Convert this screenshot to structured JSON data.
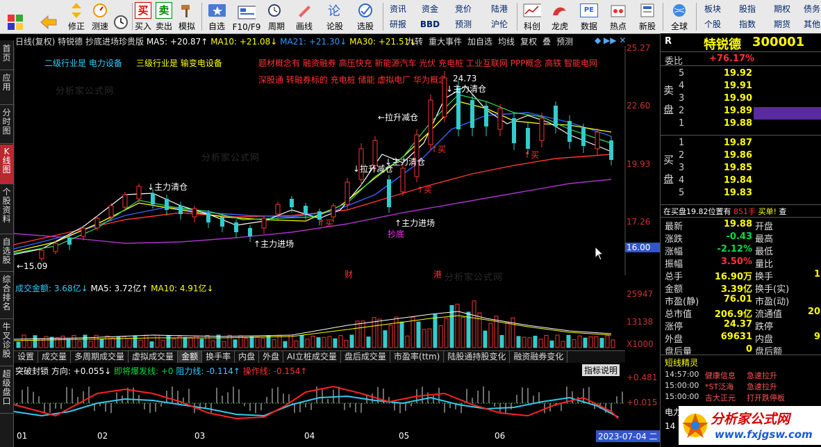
{
  "toolbar": {
    "items": [
      {
        "label": "",
        "icon": "grid-icon"
      },
      {
        "label": "",
        "icon": "back-arrow-icon"
      },
      {
        "label": "修正",
        "icon": "up-down-icon"
      },
      {
        "label": "测速",
        "icon": "speed-icon"
      },
      {
        "label": "买入",
        "icon": "buy-icon"
      },
      {
        "label": "卖出",
        "icon": "sell-icon"
      },
      {
        "label": "模拟",
        "icon": "hammer-icon"
      },
      {
        "label": "自选",
        "icon": "star-icon"
      },
      {
        "label": "F10/F9",
        "icon": "f10-icon"
      },
      {
        "label": "周期",
        "icon": "period-icon"
      },
      {
        "label": "画线",
        "icon": "pencil-icon"
      },
      {
        "label": "论股",
        "icon": "forum-icon"
      },
      {
        "label": "选股",
        "icon": "select-icon"
      },
      {
        "label": "科创",
        "icon": "kechuang-icon"
      },
      {
        "label": "龙虎",
        "icon": "dragon-icon"
      },
      {
        "label": "数据",
        "icon": "pe-icon"
      },
      {
        "label": "热点",
        "icon": "hotspot-icon"
      },
      {
        "label": "新股",
        "icon": "newstock-icon"
      },
      {
        "label": "全球",
        "icon": "globe-icon"
      }
    ],
    "buttons_a": [
      "资讯",
      "资金",
      "竞价",
      "陆港",
      "研报",
      "BBD",
      "预测",
      "沪伦"
    ],
    "buttons_b": [
      "板块",
      "股指",
      "期权",
      "债务",
      "个股",
      "指数",
      "期货",
      "其他"
    ]
  },
  "leftnav": [
    "首页",
    "应用",
    "分时图",
    "K线图",
    "个股资料",
    "自选股",
    "综合排名",
    "牛叉诊股",
    "超级盘口"
  ],
  "chart": {
    "header_left": "日线(复权)  特锐德  抄底进场珍贵版",
    "ma5": "MA5: +20.87↑",
    "ma10": "MA10: +21.08↓",
    "ma21": "MA21: +21.30↓",
    "ma30": "MA30: +21.51↓",
    "tags_top": [
      "九转",
      "重大事件",
      "加自选",
      "均线",
      "复权",
      "叠",
      "预测"
    ],
    "industry2": "二级行业是  电力设备",
    "industry3": "三级行业是  输变电设备",
    "concepts1": "题材概念有  融资融券  高压快充  新能源汽车  光伏    充电桩  工业互联网  PPP概念  高铁  智能电网",
    "concepts2": "深股通  转融券标的  充电桩  储能  虚拟电厂  华为概念",
    "price_axis": [
      "25.27",
      "22.60",
      "19.93",
      "17.26",
      "16.00"
    ],
    "annotations": {
      "low": "←15.09",
      "high": "24.73",
      "main_enter1": "主力进场",
      "main_enter2": "主力进场",
      "main_clear1": "主力清仓",
      "main_clear2": "主力清仓",
      "main_clear3": "主力清仓",
      "lift_reduce": "拉升减仓",
      "lift_reduce2": "拉升减仓",
      "buy": "买",
      "bottom": "抄底",
      "cai": "财",
      "gang": "港"
    },
    "volume_header": "成交金额: 3.68亿↓",
    "vol_ma5": "MA5: 3.72亿↑",
    "vol_ma10": "MA10: 4.91亿↓",
    "vol_axis": [
      "25947",
      "13138",
      "X1000"
    ],
    "tabs": [
      "设置",
      "成交量",
      "多周期成交量",
      "虚拟成交量",
      "金额",
      "换手率",
      "内盘",
      "外盘",
      "AI立桩成交量",
      "盘后成交量",
      "市盈率(ttm)",
      "陆股通持股变化",
      "融资融券变化"
    ],
    "indicator_header": "突破封锁 方向: +0.055↓",
    "ind_line1": "即将爆发线: +0",
    "ind_line2": "阻力线: -0.114↑",
    "ind_line3": "操作线: -0.154↑",
    "ind_desc": "指标说明",
    "ind_axis": [
      "+0.481",
      "+0.015"
    ],
    "x_axis": [
      "01",
      "02",
      "03",
      "04",
      "05",
      "06"
    ],
    "date_label": "2023-07-04 二"
  },
  "stock": {
    "code": "R",
    "name": "特锐德",
    "number": "300001",
    "weibi_label": "委比",
    "weibi_value": "+76.17%",
    "sell_label": "卖盘",
    "buy_label": "买盘",
    "sells": [
      [
        "5",
        "19.92"
      ],
      [
        "4",
        "19.91"
      ],
      [
        "3",
        "19.90"
      ],
      [
        "2",
        "19.89"
      ],
      [
        "1",
        "19.88"
      ]
    ],
    "buys": [
      [
        "1",
        "19.87"
      ],
      [
        "2",
        "19.86"
      ],
      [
        "3",
        "19.85"
      ],
      [
        "4",
        "19.84"
      ],
      [
        "5",
        "19.83"
      ]
    ],
    "note": "在买盘19.82位置有",
    "note_val": "851手",
    "note_tail": "买单!",
    "note_tail2": "查",
    "stats_left": [
      [
        "最新",
        "19.88"
      ],
      [
        "涨跌",
        "-0.43"
      ],
      [
        "涨幅",
        "-2.12%"
      ],
      [
        "振幅",
        "3.50%"
      ],
      [
        "总手",
        "16.90万"
      ],
      [
        "金额",
        "3.39亿"
      ],
      [
        "市盈(静)",
        "76.01"
      ],
      [
        "总市值",
        "206.9亿"
      ],
      [
        "涨停",
        "24.37"
      ],
      [
        "外盘",
        "69631"
      ],
      [
        "盘后量",
        "0"
      ]
    ],
    "stats_right": [
      "开盘",
      "最高",
      "最低",
      "量比",
      "换手",
      "换手(实)",
      "市盈(动)",
      "流通值",
      "跌停",
      "内盘",
      "盘后额"
    ],
    "stats_right_vals": [
      "",
      "",
      "",
      "",
      "1",
      "",
      "",
      "20",
      "",
      "9",
      ""
    ],
    "short_title": "短线精灵",
    "short_items": [
      [
        "14:57:00",
        "健康信息",
        "急速拉升"
      ],
      [
        "15:00:00",
        "*ST泛海",
        "急速拉升"
      ],
      [
        "15:00:00",
        "吉大正元",
        "打开跌停板"
      ]
    ],
    "ticker_label": "电力",
    "ticker_val": "14"
  },
  "watermark": "分析家公式网",
  "logo_text": "分析家公式网",
  "logo_url": "www.fxjgsw.com",
  "colors": {
    "up": "#ff3333",
    "down": "#00dddd",
    "ma5": "#ffffff",
    "ma10": "#ffff00",
    "ma21": "#3366ff",
    "ma30": "#ff3333",
    "ma60": "#aa33cc"
  }
}
